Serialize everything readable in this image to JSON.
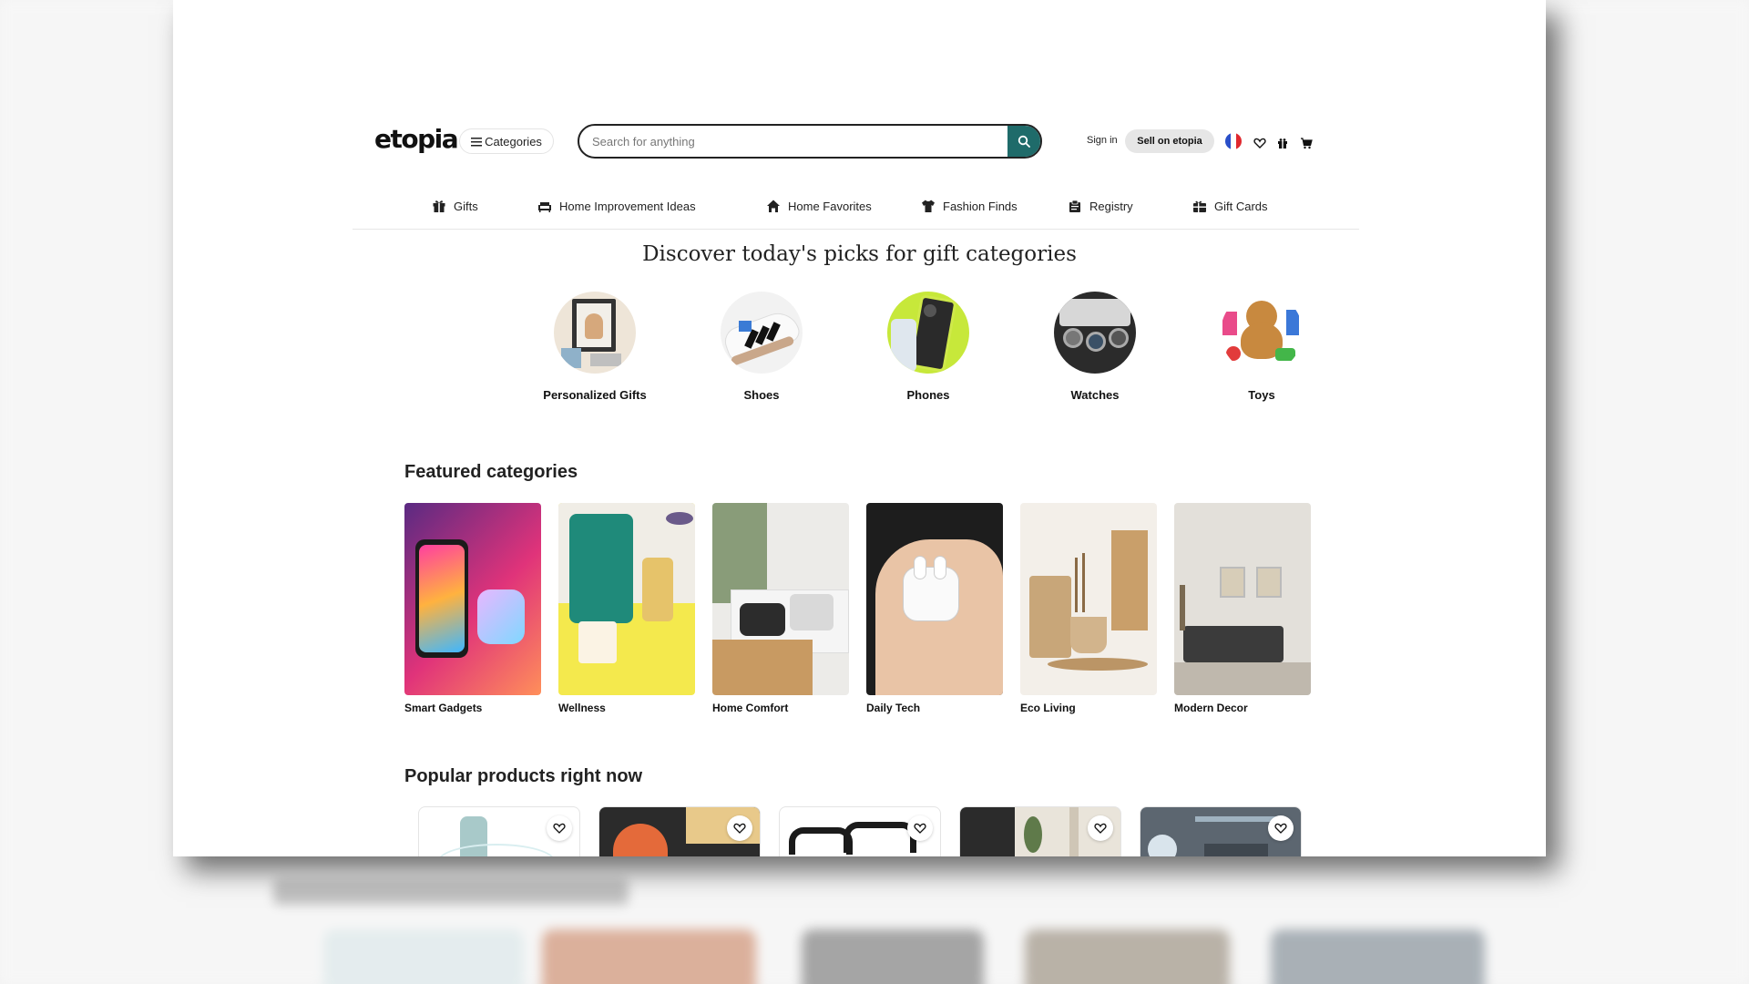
{
  "header": {
    "logo": "etopia",
    "categories_label": "Categories",
    "search_placeholder": "Search for anything",
    "sign_in": "Sign in",
    "sell_label": "Sell on etopia"
  },
  "nav": [
    {
      "label": "Gifts",
      "icon": "gift-icon"
    },
    {
      "label": "Home Improvement Ideas",
      "icon": "sofa-icon"
    },
    {
      "label": "Home Favorites",
      "icon": "house-icon"
    },
    {
      "label": "Fashion Finds",
      "icon": "shirt-icon"
    },
    {
      "label": "Registry",
      "icon": "clipboard-icon"
    },
    {
      "label": "Gift Cards",
      "icon": "gift-card-icon"
    }
  ],
  "picks": {
    "title": "Discover today's picks for gift categories",
    "items": [
      {
        "label": "Personalized Gifts"
      },
      {
        "label": "Shoes"
      },
      {
        "label": "Phones"
      },
      {
        "label": "Watches"
      },
      {
        "label": "Toys"
      }
    ]
  },
  "featured": {
    "title": "Featured categories",
    "items": [
      {
        "label": "Smart Gadgets"
      },
      {
        "label": "Wellness"
      },
      {
        "label": "Home Comfort"
      },
      {
        "label": "Daily Tech"
      },
      {
        "label": "Eco Living"
      },
      {
        "label": "Modern Decor"
      }
    ]
  },
  "popular": {
    "title": "Popular products right now"
  },
  "colors": {
    "accent": "#1f6b6a",
    "text": "#222222",
    "sell_bg": "#e6e6e6"
  }
}
